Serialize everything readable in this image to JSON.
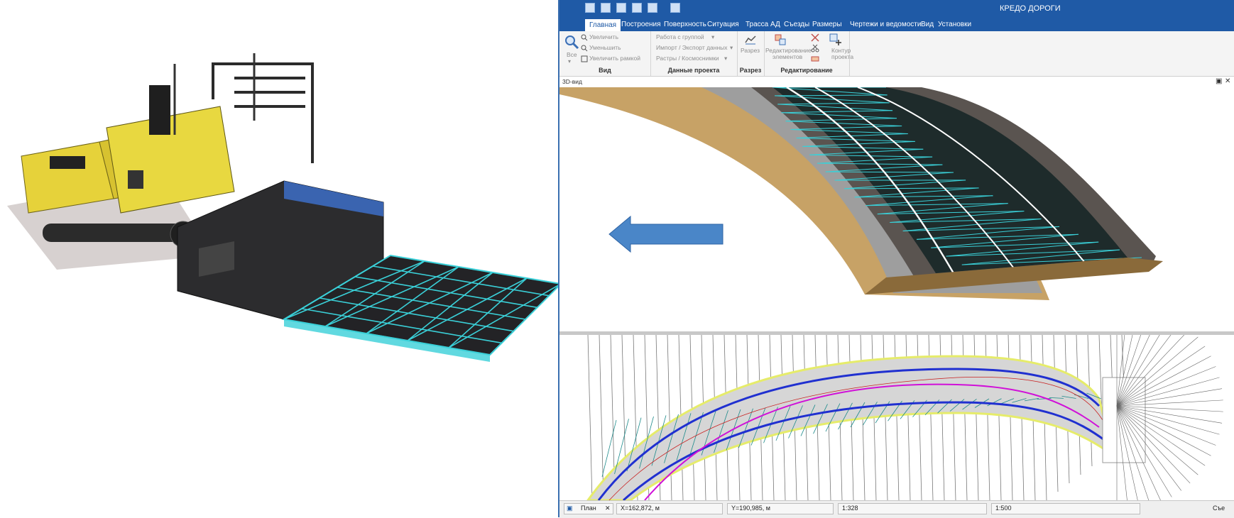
{
  "app": {
    "title": "КРЕДО ДОРОГИ"
  },
  "menu": {
    "tabs": [
      "Главная",
      "Построения",
      "Поверхность",
      "Ситуация",
      "Трасса АД",
      "Съезды",
      "Размеры",
      "Чертежи и ведомости",
      "Вид",
      "Установки"
    ],
    "active_tab": "Главная"
  },
  "ribbon": {
    "view_group": {
      "label": "Вид",
      "all_label": "Все",
      "zoom_in": "Увеличить",
      "zoom_out": "Уменьшить",
      "zoom_frame": "Увеличить рамкой"
    },
    "project_data_group": {
      "label": "Данные проекта",
      "group_work": "Работа с группой",
      "import_export": "Импорт / Экспорт данных",
      "rasters": "Растры / Космоснимки"
    },
    "section_group": {
      "label": "Разрез",
      "section_button": "Разрез"
    },
    "edit_group": {
      "label": "Редактирование",
      "edit_elements_line1": "Редактирование",
      "edit_elements_line2": "элементов",
      "contour_line1": "Контур",
      "contour_line2": "проекта"
    }
  },
  "view3d": {
    "label": "3D-вид"
  },
  "status": {
    "tab_label": "План",
    "x_coord": "X=162,872, м",
    "y_coord": "Y=190,985, м",
    "scale_current": "1:328",
    "scale_plan": "1:500",
    "right_label": "Съе"
  },
  "colors": {
    "ribbon_blue": "#1f5aa6",
    "tin_cyan": "#3ad0d8",
    "arrow_blue": "#4a86c8",
    "paver_yellow": "#e6d23a",
    "plan_axis_magenta": "#d010d8",
    "plan_edge_blue": "#2030d0"
  },
  "icons": [
    "save-icon",
    "undo-icon",
    "redo-icon",
    "zoom-in-icon",
    "zoom-out-icon",
    "zoom-frame-icon",
    "section-icon",
    "edit-elements-icon",
    "contour-icon",
    "pin-icon",
    "close-icon",
    "plan-tab-icon",
    "close-tab-icon"
  ]
}
